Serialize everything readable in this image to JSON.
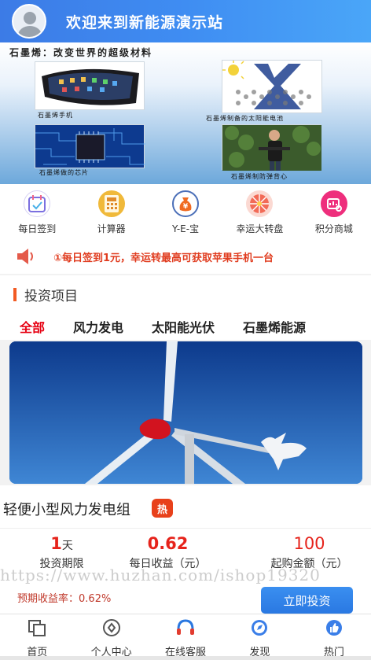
{
  "header": {
    "title": "欢迎来到新能源演示站"
  },
  "banner": {
    "title": "石墨烯：改变世界的超级材料",
    "captions": [
      "石墨烯手机",
      "石墨烯制备的太阳能电池",
      "石墨烯做的芯片",
      "石墨烯制防弹背心"
    ]
  },
  "quick_links": [
    {
      "label": "每日签到",
      "icon": "calendar-check-icon",
      "color": "#7b6fe0"
    },
    {
      "label": "计算器",
      "icon": "calculator-icon",
      "color": "#f0b93a"
    },
    {
      "label": "Y-E-宝",
      "icon": "yen-bag-icon",
      "color": "#f06b22"
    },
    {
      "label": "幸运大转盘",
      "icon": "lucky-wheel-icon",
      "color": "#f26b57"
    },
    {
      "label": "积分商城",
      "icon": "points-mall-icon",
      "color": "#ee2e7c"
    }
  ],
  "notice": {
    "text": "①每日签到1元，幸运转最高可获取苹果手机一台",
    "icon": "speaker-icon"
  },
  "section": {
    "title": "投资项目"
  },
  "tabs": [
    "全部",
    "风力发电",
    "太阳能光伏",
    "石墨烯能源"
  ],
  "product": {
    "name": "轻便小型风力发电组",
    "badge": "热",
    "term_value": "1",
    "term_unit": "天",
    "term_label": "投资期限",
    "daily_value": "0.62",
    "daily_label": "每日收益（元）",
    "min_value": "100",
    "min_label": "起购金额（元）",
    "rate_label": "预期收益率：",
    "rate_value": "0.62%",
    "button": "立即投资"
  },
  "watermark": "https://www.huzhan.com/ishop19320",
  "bottom_nav": [
    {
      "label": "首页",
      "icon": "home-icon"
    },
    {
      "label": "个人中心",
      "icon": "user-center-icon"
    },
    {
      "label": "在线客服",
      "icon": "headset-icon"
    },
    {
      "label": "发现",
      "icon": "discover-icon"
    },
    {
      "label": "热门",
      "icon": "thumbs-up-icon"
    }
  ]
}
